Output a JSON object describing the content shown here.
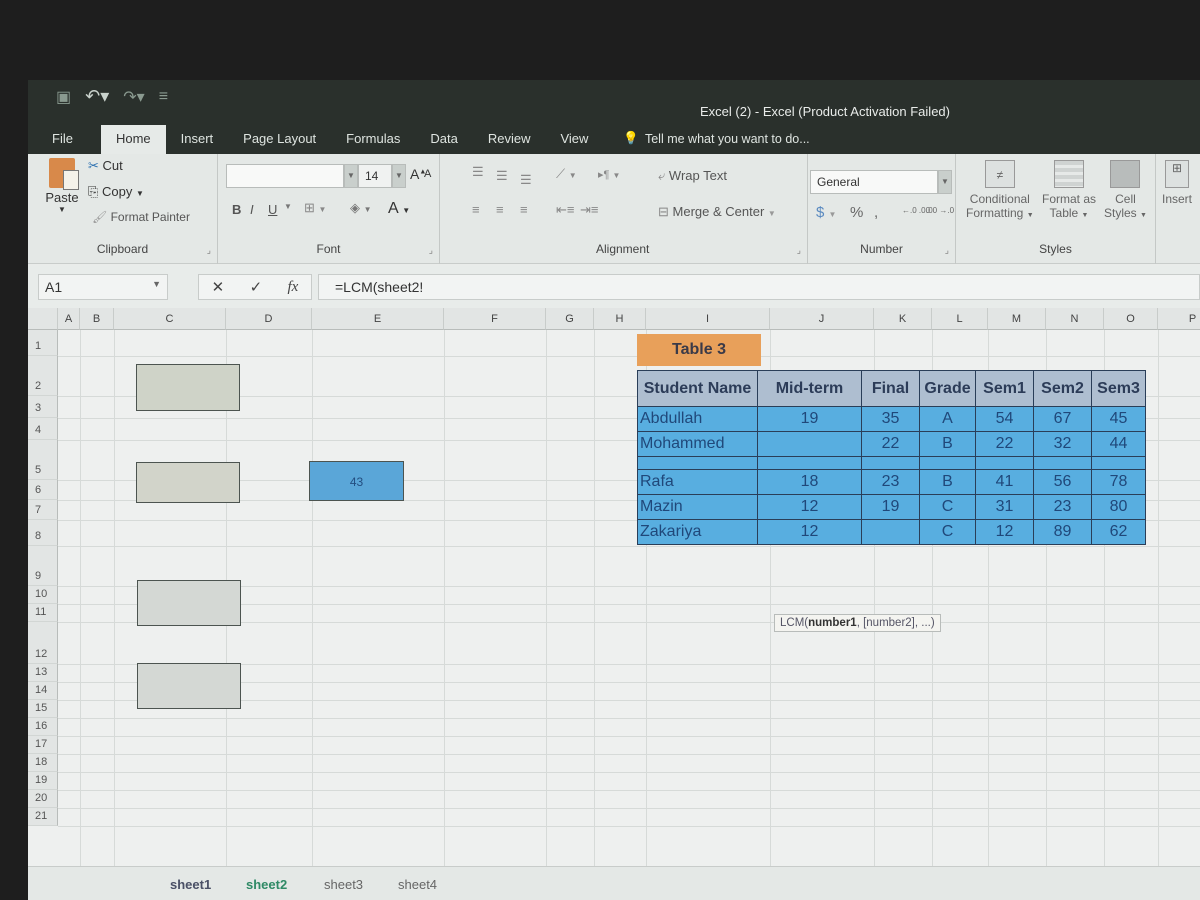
{
  "titlebar": {
    "title": "Excel (2) - Excel (Product Activation Failed)",
    "qat": {
      "save_icon": "save-icon",
      "undo_icon": "undo-icon",
      "redo_icon": "redo-icon",
      "customize_icon": "customize-qat-icon"
    }
  },
  "tabs": [
    {
      "label": "File",
      "active": false
    },
    {
      "label": "Home",
      "active": true
    },
    {
      "label": "Insert",
      "active": false
    },
    {
      "label": "Page Layout",
      "active": false
    },
    {
      "label": "Formulas",
      "active": false
    },
    {
      "label": "Data",
      "active": false
    },
    {
      "label": "Review",
      "active": false
    },
    {
      "label": "View",
      "active": false
    }
  ],
  "tell_me": "Tell me what you want to do...",
  "ribbon": {
    "clipboard": {
      "label": "Clipboard",
      "paste": "Paste",
      "cut": "Cut",
      "copy": "Copy",
      "format_painter": "Format Painter"
    },
    "font": {
      "label": "Font",
      "font_name": "",
      "font_size": "14",
      "grow": "A",
      "shrink": "A",
      "bold": "B",
      "italic": "I",
      "underline": "U",
      "font_color": "A"
    },
    "alignment": {
      "label": "Alignment",
      "wrap_text": "Wrap Text",
      "merge_center": "Merge & Center"
    },
    "number": {
      "label": "Number",
      "format": "General",
      "currency": "$",
      "percent": "%",
      "comma": ",",
      "inc_decimal": "←.0 .00",
      "dec_decimal": ".00 →.0"
    },
    "styles": {
      "label": "Styles",
      "conditional_formatting": [
        "Conditional",
        "Formatting"
      ],
      "format_as_table": [
        "Format as",
        "Table"
      ],
      "cell_styles": [
        "Cell",
        "Styles"
      ]
    },
    "cells": {
      "insert": "Insert"
    }
  },
  "formula_bar": {
    "name_box": "A1",
    "cancel": "✕",
    "enter": "✓",
    "fx": "fx",
    "formula": "=LCM(sheet2!"
  },
  "grid": {
    "columns": [
      "A",
      "B",
      "C",
      "D",
      "E",
      "F",
      "G",
      "H",
      "I",
      "J",
      "K",
      "L",
      "M",
      "N",
      "O",
      "P"
    ],
    "rows": [
      "1",
      "2",
      "3",
      "4",
      "5",
      "6",
      "7",
      "8",
      "9",
      "10",
      "11",
      "12",
      "13",
      "14",
      "15",
      "16",
      "17",
      "18",
      "19",
      "20",
      "21"
    ],
    "blue_shape_value": "43"
  },
  "table3": {
    "title": "Table 3",
    "headers": [
      "Student Name",
      "Mid-term",
      "Final",
      "Grade",
      "Sem1",
      "Sem2",
      "Sem3"
    ],
    "rows": [
      [
        "Abdullah",
        "19",
        "35",
        "A",
        "54",
        "67",
        "45"
      ],
      [
        "Mohammed",
        "",
        "22",
        "B",
        "22",
        "32",
        "44"
      ],
      [
        "Rafa",
        "18",
        "23",
        "B",
        "41",
        "56",
        "78"
      ],
      [
        "Mazin",
        "12",
        "19",
        "C",
        "31",
        "23",
        "80"
      ],
      [
        "Zakariya",
        "12",
        "",
        "C",
        "12",
        "89",
        "62"
      ]
    ],
    "colors": {
      "title_bg": "#e8a05a",
      "header_bg": "#aebed0",
      "row_bg": "#58aee0"
    }
  },
  "tooltip": {
    "fn": "LCM(",
    "arg1": "number1",
    "rest": ", [number2], ...)"
  },
  "sheets": [
    {
      "label": "sheet1",
      "active": false
    },
    {
      "label": "sheet2",
      "active": true
    },
    {
      "label": "sheet3",
      "active": false
    },
    {
      "label": "sheet4",
      "active": false
    }
  ]
}
